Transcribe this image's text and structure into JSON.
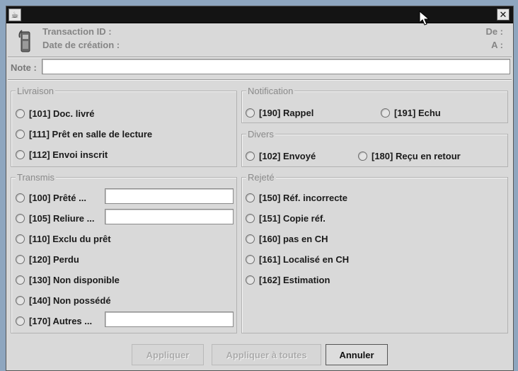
{
  "window": {
    "close_glyph": "✕",
    "app_icon_glyph": "☕"
  },
  "header": {
    "transaction_label": "Transaction ID :",
    "created_label": "Date de création :",
    "from_label": "De :",
    "to_label": "A :"
  },
  "note": {
    "label": "Note :",
    "value": ""
  },
  "livraison": {
    "title": "Livraison",
    "options": [
      "[101] Doc. livré",
      "[111] Prêt en salle de lecture",
      "[112] Envoi inscrit"
    ]
  },
  "notification": {
    "title": "Notification",
    "options": [
      "[190] Rappel",
      "[191] Echu"
    ]
  },
  "divers": {
    "title": "Divers",
    "options": [
      "[102] Envoyé",
      "[180] Reçu en retour"
    ]
  },
  "transmis": {
    "title": "Transmis",
    "options": [
      "[100] Prêté ...",
      "[105] Reliure ...",
      "[110] Exclu du prêt",
      "[120] Perdu",
      "[130] Non disponible",
      "[140] Non possédé",
      "[170] Autres ..."
    ],
    "fields": [
      "",
      "",
      ""
    ]
  },
  "rejete": {
    "title": "Rejeté",
    "options": [
      "[150] Réf. incorrecte",
      "[151] Copie réf.",
      "[160] pas en CH",
      "[161] Localisé en CH",
      "[162] Estimation"
    ]
  },
  "buttons": {
    "apply": "Appliquer",
    "apply_all": "Appliquer à toutes",
    "cancel": "Annuler"
  },
  "icons": {
    "app": "coffee-cup-icon",
    "header": "telephone-icon",
    "close": "close-icon",
    "cursor": "mouse-pointer-icon"
  }
}
